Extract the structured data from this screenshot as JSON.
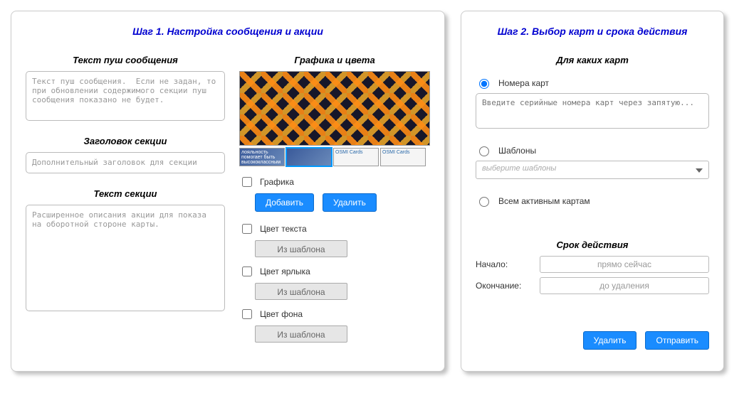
{
  "step1": {
    "title": "Шаг 1. Настройка сообщения и акции",
    "push_label": "Текст пуш сообщения",
    "push_placeholder": "Текст пуш сообщения.  Если не задан, то при обновлении содержимого секции пуш сообщения показано не будет.",
    "header_label": "Заголовок секции",
    "header_placeholder": "Дополнительный заголовок для секции",
    "body_label": "Текст секции",
    "body_placeholder": "Расширенное описания акции для показа на оборотной стороне карты.",
    "graphics_label": "Графика и цвета",
    "chk_graphic": "Графика",
    "btn_add": "Добавить",
    "btn_delete": "Удалить",
    "chk_text_color": "Цвет текста",
    "chk_label_color": "Цвет ярлыка",
    "chk_bg_color": "Цвет фона",
    "from_template": "Из шаблона",
    "thumbs": [
      {
        "text": "лояльность помогает быть высококлассным"
      },
      {
        "text": ""
      },
      {
        "text": "OSMI Cards"
      },
      {
        "text": "OSMI Cards"
      }
    ]
  },
  "step2": {
    "title": "Шаг 2. Выбор карт и срока действия",
    "cards_label": "Для каких карт",
    "opt_numbers": "Номера карт",
    "numbers_placeholder": "Введите серийные номера карт через запятую...",
    "opt_templates": "Шаблоны",
    "templates_placeholder": "выберите шаблоны",
    "opt_all": "Всем активным картам",
    "duration_label": "Срок действия",
    "start_label": "Начало:",
    "start_value": "прямо сейчас",
    "end_label": "Окончание:",
    "end_value": "до удаления",
    "btn_delete": "Удалить",
    "btn_send": "Отправить"
  }
}
